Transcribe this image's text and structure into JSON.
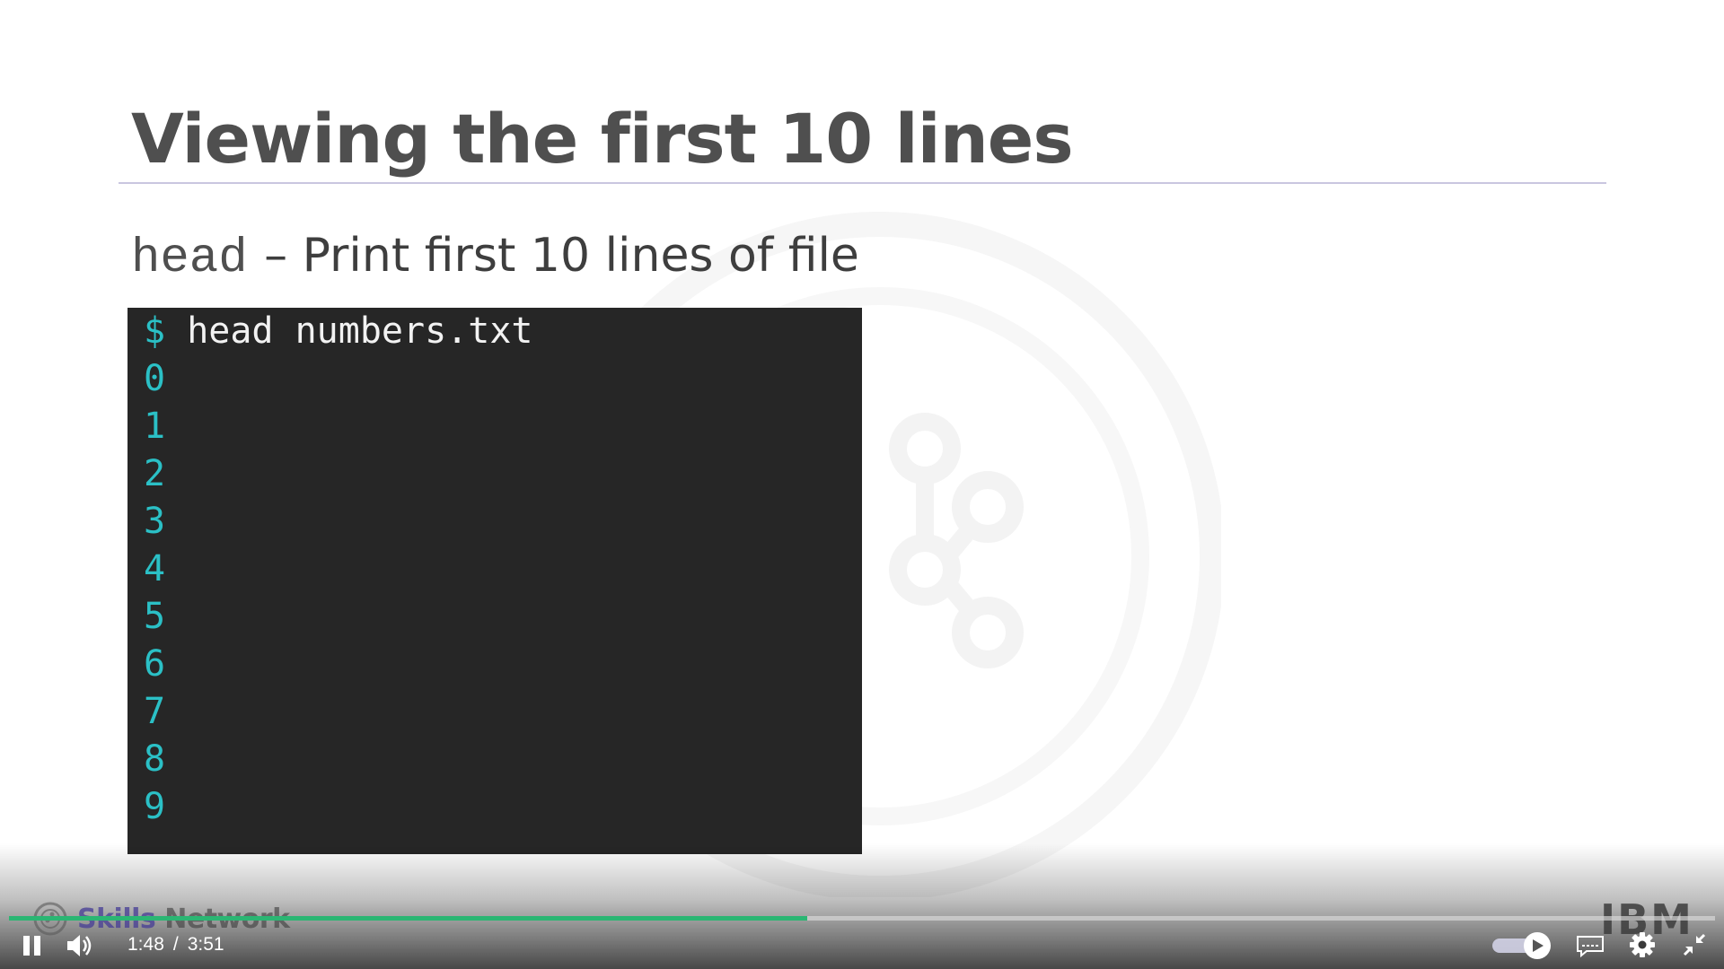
{
  "slide": {
    "title": "Viewing the first 10 lines",
    "command": {
      "name": "head",
      "description": "– Print first 10 lines of file"
    },
    "terminal": {
      "prompt": "$",
      "command": "head numbers.txt",
      "output": [
        "0",
        "1",
        "2",
        "3",
        "4",
        "5",
        "6",
        "7",
        "8",
        "9"
      ]
    }
  },
  "branding": {
    "left_text_1": "Skills",
    "left_text_2": "Network",
    "right_logo": "IBM"
  },
  "player": {
    "current_time": "1:48",
    "separator": "/",
    "duration": "3:51",
    "progress_fraction": 0.468,
    "progress_color": "#2bb673",
    "icons": {
      "play_pause": "pause-icon",
      "volume": "volume-icon",
      "autoplay": "autoplay-toggle-icon",
      "captions": "captions-icon",
      "settings": "gear-icon",
      "fullscreen": "exit-fullscreen-icon"
    }
  },
  "colors": {
    "terminal_bg": "#262626",
    "terminal_accent": "#2bc0c6",
    "title": "#4f4f4f"
  }
}
